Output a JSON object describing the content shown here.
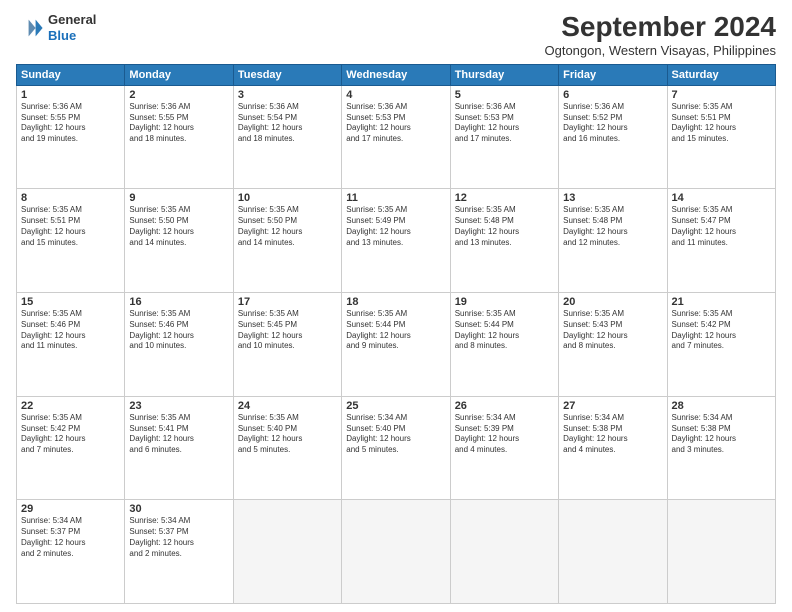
{
  "logo": {
    "line1": "General",
    "line2": "Blue"
  },
  "header": {
    "month": "September 2024",
    "location": "Ogtongon, Western Visayas, Philippines"
  },
  "weekdays": [
    "Sunday",
    "Monday",
    "Tuesday",
    "Wednesday",
    "Thursday",
    "Friday",
    "Saturday"
  ],
  "weeks": [
    [
      {
        "day": "1",
        "info": "Sunrise: 5:36 AM\nSunset: 5:55 PM\nDaylight: 12 hours\nand 19 minutes."
      },
      {
        "day": "2",
        "info": "Sunrise: 5:36 AM\nSunset: 5:55 PM\nDaylight: 12 hours\nand 18 minutes."
      },
      {
        "day": "3",
        "info": "Sunrise: 5:36 AM\nSunset: 5:54 PM\nDaylight: 12 hours\nand 18 minutes."
      },
      {
        "day": "4",
        "info": "Sunrise: 5:36 AM\nSunset: 5:53 PM\nDaylight: 12 hours\nand 17 minutes."
      },
      {
        "day": "5",
        "info": "Sunrise: 5:36 AM\nSunset: 5:53 PM\nDaylight: 12 hours\nand 17 minutes."
      },
      {
        "day": "6",
        "info": "Sunrise: 5:36 AM\nSunset: 5:52 PM\nDaylight: 12 hours\nand 16 minutes."
      },
      {
        "day": "7",
        "info": "Sunrise: 5:35 AM\nSunset: 5:51 PM\nDaylight: 12 hours\nand 15 minutes."
      }
    ],
    [
      {
        "day": "8",
        "info": "Sunrise: 5:35 AM\nSunset: 5:51 PM\nDaylight: 12 hours\nand 15 minutes."
      },
      {
        "day": "9",
        "info": "Sunrise: 5:35 AM\nSunset: 5:50 PM\nDaylight: 12 hours\nand 14 minutes."
      },
      {
        "day": "10",
        "info": "Sunrise: 5:35 AM\nSunset: 5:50 PM\nDaylight: 12 hours\nand 14 minutes."
      },
      {
        "day": "11",
        "info": "Sunrise: 5:35 AM\nSunset: 5:49 PM\nDaylight: 12 hours\nand 13 minutes."
      },
      {
        "day": "12",
        "info": "Sunrise: 5:35 AM\nSunset: 5:48 PM\nDaylight: 12 hours\nand 13 minutes."
      },
      {
        "day": "13",
        "info": "Sunrise: 5:35 AM\nSunset: 5:48 PM\nDaylight: 12 hours\nand 12 minutes."
      },
      {
        "day": "14",
        "info": "Sunrise: 5:35 AM\nSunset: 5:47 PM\nDaylight: 12 hours\nand 11 minutes."
      }
    ],
    [
      {
        "day": "15",
        "info": "Sunrise: 5:35 AM\nSunset: 5:46 PM\nDaylight: 12 hours\nand 11 minutes."
      },
      {
        "day": "16",
        "info": "Sunrise: 5:35 AM\nSunset: 5:46 PM\nDaylight: 12 hours\nand 10 minutes."
      },
      {
        "day": "17",
        "info": "Sunrise: 5:35 AM\nSunset: 5:45 PM\nDaylight: 12 hours\nand 10 minutes."
      },
      {
        "day": "18",
        "info": "Sunrise: 5:35 AM\nSunset: 5:44 PM\nDaylight: 12 hours\nand 9 minutes."
      },
      {
        "day": "19",
        "info": "Sunrise: 5:35 AM\nSunset: 5:44 PM\nDaylight: 12 hours\nand 8 minutes."
      },
      {
        "day": "20",
        "info": "Sunrise: 5:35 AM\nSunset: 5:43 PM\nDaylight: 12 hours\nand 8 minutes."
      },
      {
        "day": "21",
        "info": "Sunrise: 5:35 AM\nSunset: 5:42 PM\nDaylight: 12 hours\nand 7 minutes."
      }
    ],
    [
      {
        "day": "22",
        "info": "Sunrise: 5:35 AM\nSunset: 5:42 PM\nDaylight: 12 hours\nand 7 minutes."
      },
      {
        "day": "23",
        "info": "Sunrise: 5:35 AM\nSunset: 5:41 PM\nDaylight: 12 hours\nand 6 minutes."
      },
      {
        "day": "24",
        "info": "Sunrise: 5:35 AM\nSunset: 5:40 PM\nDaylight: 12 hours\nand 5 minutes."
      },
      {
        "day": "25",
        "info": "Sunrise: 5:34 AM\nSunset: 5:40 PM\nDaylight: 12 hours\nand 5 minutes."
      },
      {
        "day": "26",
        "info": "Sunrise: 5:34 AM\nSunset: 5:39 PM\nDaylight: 12 hours\nand 4 minutes."
      },
      {
        "day": "27",
        "info": "Sunrise: 5:34 AM\nSunset: 5:38 PM\nDaylight: 12 hours\nand 4 minutes."
      },
      {
        "day": "28",
        "info": "Sunrise: 5:34 AM\nSunset: 5:38 PM\nDaylight: 12 hours\nand 3 minutes."
      }
    ],
    [
      {
        "day": "29",
        "info": "Sunrise: 5:34 AM\nSunset: 5:37 PM\nDaylight: 12 hours\nand 2 minutes."
      },
      {
        "day": "30",
        "info": "Sunrise: 5:34 AM\nSunset: 5:37 PM\nDaylight: 12 hours\nand 2 minutes."
      },
      {
        "day": "",
        "info": ""
      },
      {
        "day": "",
        "info": ""
      },
      {
        "day": "",
        "info": ""
      },
      {
        "day": "",
        "info": ""
      },
      {
        "day": "",
        "info": ""
      }
    ]
  ]
}
